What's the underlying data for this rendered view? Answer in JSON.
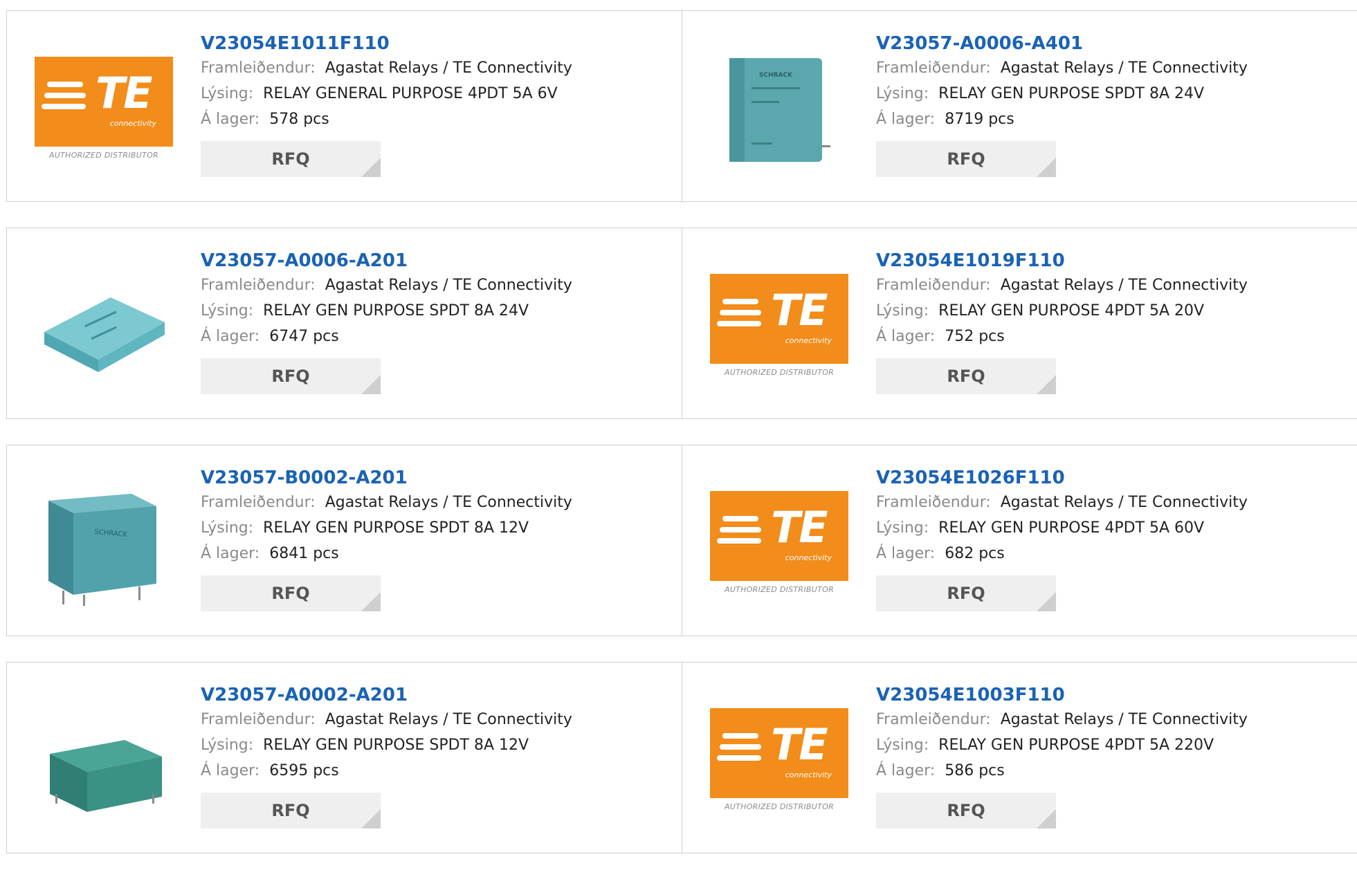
{
  "labels": {
    "manufacturer": "Framleiðendur:",
    "description": "Lýsing:",
    "stock": "Á lager:",
    "rfq": "RFQ"
  },
  "te_logo": {
    "text": "TE",
    "sub": "connectivity",
    "authorized": "AUTHORIZED DISTRIBUTOR"
  },
  "products": [
    {
      "part": "V23054E1011F110",
      "manufacturer": "Agastat Relays / TE Connectivity",
      "description": "RELAY GENERAL PURPOSE 4PDT 5A 6V",
      "stock": "578 pcs",
      "image": "te-logo"
    },
    {
      "part": "V23057-A0006-A401",
      "manufacturer": "Agastat Relays / TE Connectivity",
      "description": "RELAY GEN PURPOSE SPDT 8A 24V",
      "stock": "8719 pcs",
      "image": "relay-upright-teal"
    },
    {
      "part": "V23057-A0006-A201",
      "manufacturer": "Agastat Relays / TE Connectivity",
      "description": "RELAY GEN PURPOSE SPDT 8A 24V",
      "stock": "6747 pcs",
      "image": "relay-flat-teal"
    },
    {
      "part": "V23054E1019F110",
      "manufacturer": "Agastat Relays / TE Connectivity",
      "description": "RELAY GEN PURPOSE 4PDT 5A 20V",
      "stock": "752 pcs",
      "image": "te-logo"
    },
    {
      "part": "V23057-B0002-A201",
      "manufacturer": "Agastat Relays / TE Connectivity",
      "description": "RELAY GEN PURPOSE SPDT 8A 12V",
      "stock": "6841 pcs",
      "image": "relay-upright-teal"
    },
    {
      "part": "V23054E1026F110",
      "manufacturer": "Agastat Relays / TE Connectivity",
      "description": "RELAY GEN PURPOSE 4PDT 5A 60V",
      "stock": "682 pcs",
      "image": "te-logo"
    },
    {
      "part": "V23057-A0002-A201",
      "manufacturer": "Agastat Relays / TE Connectivity",
      "description": "RELAY GEN PURPOSE SPDT 8A 12V",
      "stock": "6595 pcs",
      "image": "relay-flat-green"
    },
    {
      "part": "V23054E1003F110",
      "manufacturer": "Agastat Relays / TE Connectivity",
      "description": "RELAY GEN PURPOSE 4PDT 5A 220V",
      "stock": "586 pcs",
      "image": "te-logo"
    }
  ],
  "colors": {
    "link": "#1a62b5",
    "te_orange": "#f28c1a",
    "relay_teal": "#5bb0b8",
    "relay_green": "#3f9a8e"
  }
}
